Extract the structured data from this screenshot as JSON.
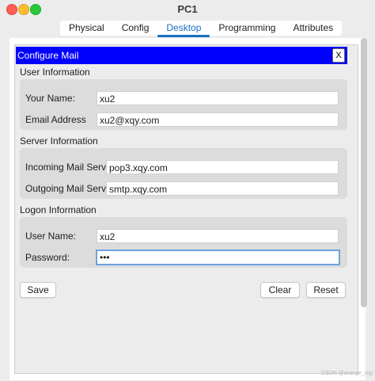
{
  "window": {
    "title": "PC1"
  },
  "tabs": [
    {
      "label": "Physical"
    },
    {
      "label": "Config"
    },
    {
      "label": "Desktop",
      "active": true
    },
    {
      "label": "Programming"
    },
    {
      "label": "Attributes"
    }
  ],
  "dialog": {
    "title": "Configure Mail",
    "close_label": "X",
    "header_color": "#0000ff",
    "user_info": {
      "heading": "User Information",
      "your_name_label": "Your Name:",
      "your_name_value": "xu2",
      "email_label": "Email Address",
      "email_value": "xu2@xqy.com"
    },
    "server_info": {
      "heading": "Server Information",
      "incoming_label": "Incoming Mail Server",
      "incoming_value": "pop3.xqy.com",
      "outgoing_label": "Outgoing Mail Server",
      "outgoing_value": "smtp.xqy.com"
    },
    "logon_info": {
      "heading": "Logon Information",
      "user_name_label": "User Name:",
      "user_name_value": "xu2",
      "password_label": "Password:",
      "password_value": "•••"
    },
    "buttons": {
      "save": "Save",
      "clear": "Clear",
      "reset": "Reset"
    }
  },
  "watermark": "CSDN @orange_xqy"
}
